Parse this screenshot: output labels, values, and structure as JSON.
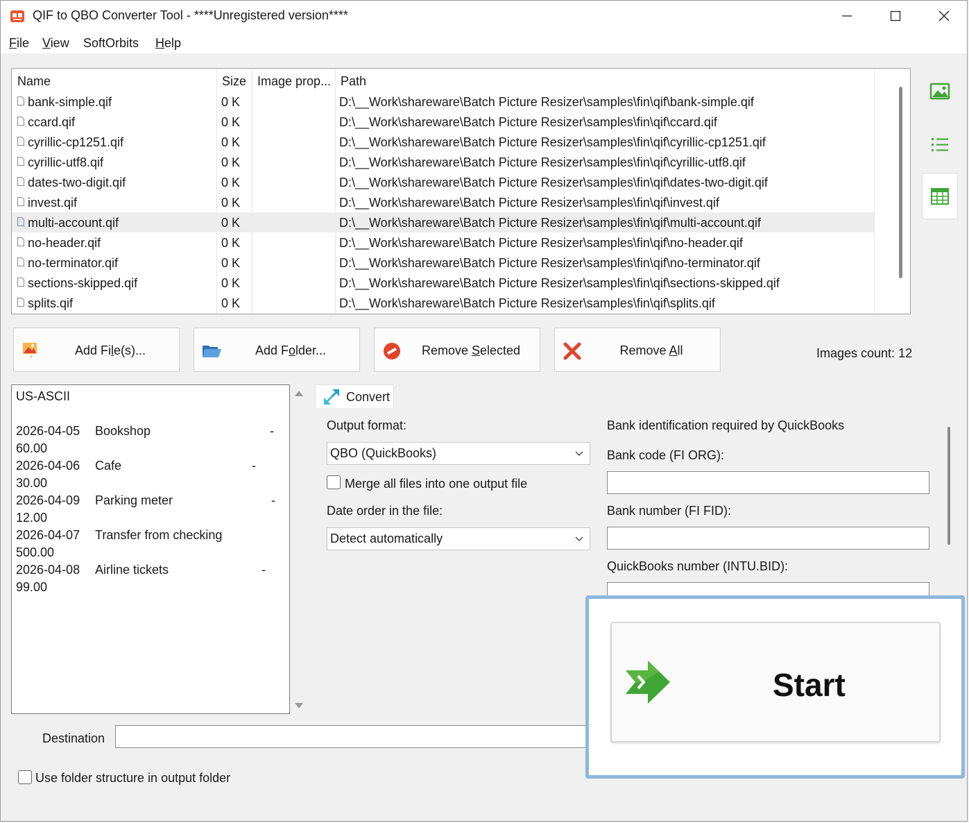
{
  "window": {
    "title": "QIF to QBO Converter Tool - ****Unregistered version****"
  },
  "menu": {
    "file_u": "F",
    "file_rest": "ile",
    "view_u": "V",
    "view_rest": "iew",
    "softorbits": "SoftOrbits",
    "help_u": "H",
    "help_rest": "elp"
  },
  "filelist": {
    "columns": [
      "Name",
      "Size",
      "Image prop...",
      "Path"
    ],
    "rows": [
      {
        "name": "bank-simple.qif",
        "size": "0 K",
        "prop": "",
        "path": "D:\\__Work\\shareware\\Batch Picture Resizer\\samples\\fin\\qif\\bank-simple.qif"
      },
      {
        "name": "ccard.qif",
        "size": "0 K",
        "prop": "",
        "path": "D:\\__Work\\shareware\\Batch Picture Resizer\\samples\\fin\\qif\\ccard.qif"
      },
      {
        "name": "cyrillic-cp1251.qif",
        "size": "0 K",
        "prop": "",
        "path": "D:\\__Work\\shareware\\Batch Picture Resizer\\samples\\fin\\qif\\cyrillic-cp1251.qif"
      },
      {
        "name": "cyrillic-utf8.qif",
        "size": "0 K",
        "prop": "",
        "path": "D:\\__Work\\shareware\\Batch Picture Resizer\\samples\\fin\\qif\\cyrillic-utf8.qif"
      },
      {
        "name": "dates-two-digit.qif",
        "size": "0 K",
        "prop": "",
        "path": "D:\\__Work\\shareware\\Batch Picture Resizer\\samples\\fin\\qif\\dates-two-digit.qif"
      },
      {
        "name": "invest.qif",
        "size": "0 K",
        "prop": "",
        "path": "D:\\__Work\\shareware\\Batch Picture Resizer\\samples\\fin\\qif\\invest.qif"
      },
      {
        "name": "multi-account.qif",
        "size": "0 K",
        "prop": "",
        "path": "D:\\__Work\\shareware\\Batch Picture Resizer\\samples\\fin\\qif\\multi-account.qif"
      },
      {
        "name": "no-header.qif",
        "size": "0 K",
        "prop": "",
        "path": "D:\\__Work\\shareware\\Batch Picture Resizer\\samples\\fin\\qif\\no-header.qif"
      },
      {
        "name": "no-terminator.qif",
        "size": "0 K",
        "prop": "",
        "path": "D:\\__Work\\shareware\\Batch Picture Resizer\\samples\\fin\\qif\\no-terminator.qif"
      },
      {
        "name": "sections-skipped.qif",
        "size": "0 K",
        "prop": "",
        "path": "D:\\__Work\\shareware\\Batch Picture Resizer\\samples\\fin\\qif\\sections-skipped.qif"
      },
      {
        "name": "splits.qif",
        "size": "0 K",
        "prop": "",
        "path": "D:\\__Work\\shareware\\Batch Picture Resizer\\samples\\fin\\qif\\splits.qif"
      }
    ]
  },
  "buttons": {
    "add_files_a": "Add Fi",
    "add_files_u": "l",
    "add_files_b": "e(s)...",
    "add_folder_a": "Add F",
    "add_folder_u": "o",
    "add_folder_b": "lder...",
    "remove_selected_a": "Remove ",
    "remove_selected_u": "S",
    "remove_selected_b": "elected",
    "remove_all_a": "Remove ",
    "remove_all_u": "A",
    "remove_all_b": "ll"
  },
  "images_count": "Images count: 12",
  "preview": {
    "encoding": "US-ASCII",
    "entries": [
      {
        "date": "2026-04-05",
        "desc": "Bookshop",
        "dash": "-",
        "amount": "60.00"
      },
      {
        "date": "2026-04-06",
        "desc": "Cafe",
        "dash": "-",
        "amount": "30.00"
      },
      {
        "date": "2026-04-09",
        "desc": "Parking meter",
        "dash": "-",
        "amount": "12.00"
      },
      {
        "date": "2026-04-07",
        "desc": "Transfer from checking",
        "dash": "",
        "amount": "500.00"
      },
      {
        "date": "2026-04-08",
        "desc": "Airline tickets",
        "dash": "-",
        "amount": "99.00"
      }
    ]
  },
  "convert": {
    "tab_label": "Convert",
    "output_format_label": "Output format:",
    "output_format_value": "QBO (QuickBooks)",
    "merge_label": "Merge all files into one output file",
    "merge_checked": false,
    "date_order_label": "Date order in the file:",
    "date_order_value": "Detect automatically",
    "bank_id_title": "Bank identification required by QuickBooks",
    "bank_code_label": "Bank code (FI ORG):",
    "bank_code_value": "",
    "bank_number_label": "Bank number (FI FID):",
    "bank_number_value": "",
    "qb_number_label": "QuickBooks number (INTU.BID):",
    "qb_number_value": ""
  },
  "destination": {
    "label": "Destination",
    "value": ""
  },
  "folder_structure_label": "Use folder structure in output folder",
  "start_label": "Start",
  "colors": {
    "accent_green": "#3fa535",
    "highlight_blue": "#8fb8dc",
    "remove_red": "#e0452a"
  }
}
